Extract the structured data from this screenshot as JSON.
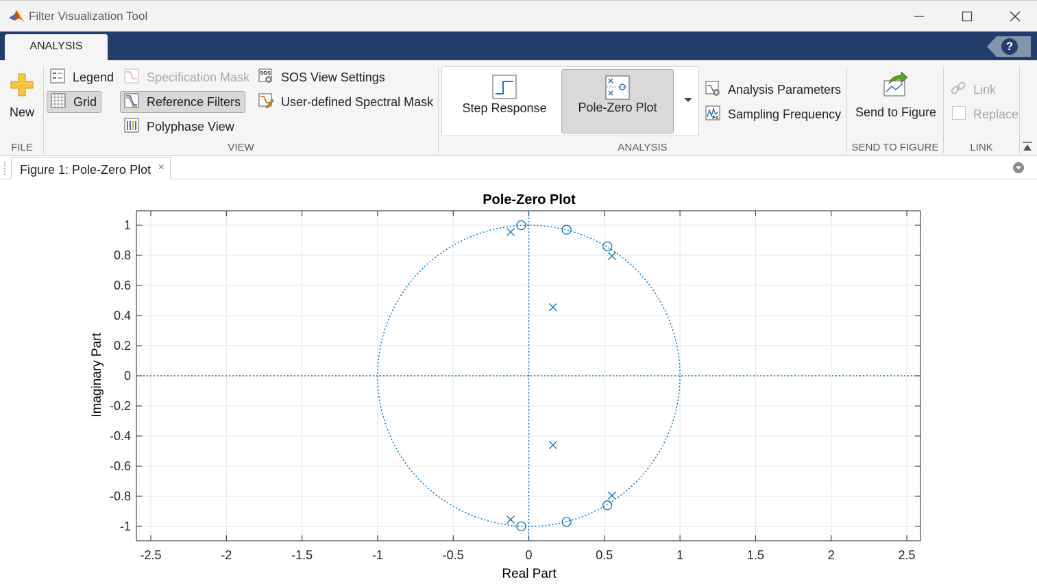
{
  "window": {
    "title": "Filter Visualization Tool",
    "minimize_icon": "minimize-icon",
    "maximize_icon": "maximize-icon",
    "close_icon": "close-icon"
  },
  "ribbon": {
    "tab_label": "ANALYSIS",
    "help_label": "?"
  },
  "toolstrip": {
    "file": {
      "new_label": "New",
      "section_label": "FILE"
    },
    "view": {
      "legend_label": "Legend",
      "grid_label": "Grid",
      "spec_mask_label": "Specification Mask",
      "reference_filters_label": "Reference Filters",
      "polyphase_view_label": "Polyphase View",
      "sos_view_settings_label": "SOS View Settings",
      "user_spectral_mask_label": "User-defined Spectral Mask",
      "section_label": "VIEW"
    },
    "analysis": {
      "step_response_label": "Step Response",
      "pole_zero_label": "Pole-Zero Plot",
      "analysis_parameters_label": "Analysis Parameters",
      "sampling_frequency_label": "Sampling Frequency",
      "section_label": "ANALYSIS"
    },
    "send_to_figure": {
      "send_label": "Send to Figure",
      "section_label": "SEND TO FIGURE"
    },
    "link": {
      "link_label": "Link",
      "replace_label": "Replace",
      "section_label": "LINK"
    }
  },
  "document": {
    "tab_label": "Figure 1: Pole-Zero Plot",
    "tab_close": "×"
  },
  "colors": {
    "accent_navy": "#233e6c",
    "plot_blue": "#0072bd"
  },
  "chart_data": {
    "type": "scatter",
    "title": "Pole-Zero Plot",
    "xlabel": "Real Part",
    "ylabel": "Imaginary Part",
    "xlim": [
      -2.5,
      2.5
    ],
    "ylim": [
      -1.1,
      1.1
    ],
    "x_ticks": [
      -2.5,
      -2,
      -1.5,
      -1,
      -0.5,
      0,
      0.5,
      1,
      1.5,
      2,
      2.5
    ],
    "x_tick_labels": [
      "-2.5",
      "-2",
      "-1.5",
      "-1",
      "-0.5",
      "0",
      "0.5",
      "1",
      "1.5",
      "2",
      "2.5"
    ],
    "y_ticks": [
      1,
      0.8,
      0.6,
      0.4,
      0.2,
      0,
      -0.2,
      -0.4,
      -0.6,
      -0.8,
      -1
    ],
    "y_tick_labels": [
      "1",
      "0.8",
      "0.6",
      "0.4",
      "0.2",
      "0",
      "-0.2",
      "-0.4",
      "-0.6",
      "-0.8",
      "-1"
    ],
    "grid": true,
    "unit_circle": true,
    "series": [
      {
        "marker": "o",
        "x": [
          -0.05,
          0.25,
          0.52,
          -0.05,
          0.25,
          0.52
        ],
        "y": [
          1.0,
          0.97,
          0.86,
          -1.0,
          -0.97,
          -0.86
        ]
      },
      {
        "marker": "x",
        "x": [
          -0.12,
          0.55,
          0.16,
          -0.12,
          0.55,
          0.16
        ],
        "y": [
          0.955,
          0.795,
          0.455,
          -0.955,
          -0.795,
          -0.46
        ]
      }
    ]
  }
}
